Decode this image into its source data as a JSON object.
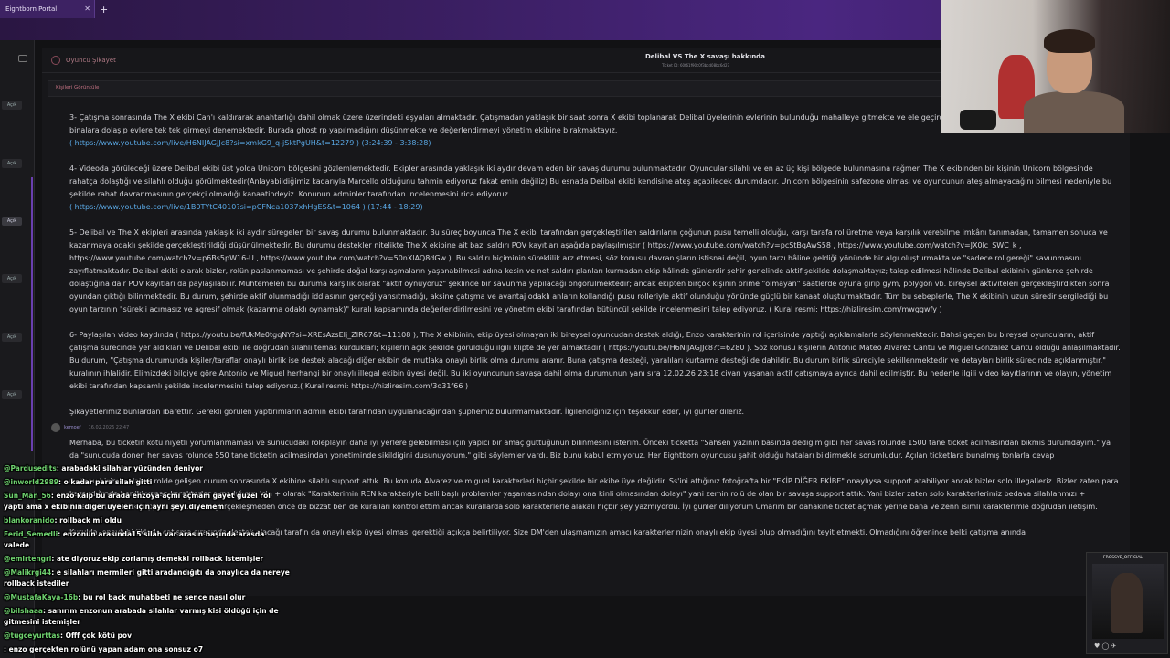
{
  "browser": {
    "tab_label": "Eightborn Portal",
    "tab_close": "✕",
    "new_tab": "+"
  },
  "sidebar": {
    "badges": [
      "Açık",
      "Açık",
      "Açık",
      "Açık",
      "Açık",
      "Açık"
    ]
  },
  "header": {
    "section": "Oyuncu Şikayet",
    "title": "Delibal VS The X savaşı hakkında",
    "ticket_id": "Ticket ID: 60f61f90c0f3bcd08bc6d27"
  },
  "subbar_label": "Kişileri Görüntüle",
  "report": {
    "p3": "3- Çatışma sonrasında The X ekibi Can'ı kaldırarak anahtarlığı dahil olmak üzere üzerindeki eşyaları almaktadır. Çatışmadan yaklaşık bir saat sonra X ekibi toplanarak Delibal üyelerinin evlerinin bulunduğu mahalleye gitmekte ve ele geçirdikleri anahtarlarla boyunca mahalledeki binalara dolaşıp evlere tek tek girmeyi denemektedir. Burada ghost rp yapılmadığını düşünmekte ve değerlendirmeyi yönetim ekibine bırakmaktayız.",
    "p3_link": "( https://www.youtube.com/live/H6NIJAGJJc8?si=xmkG9_q-jSktPgUH&t=12279 ) (3:24:39 - 3:38:28)",
    "p4": "4- Videoda görüleceği üzere Delibal ekibi üst yolda Unicorn bölgesini gözlemlemektedir. Ekipler arasında yaklaşık iki aydır devam eden bir savaş durumu bulunmaktadır. Oyuncular silahlı ve en az üç kişi bölgede bulunmasına rağmen The X ekibinden bir kişinin Unicorn bölgesinde rahatça dolaştığı ve silahlı olduğu görülmektedir(Anlayabildiğimiz kadarıyla Marcello olduğunu tahmin ediyoruz fakat emin değiliz) Bu esnada Delibal ekibi kendisine ateş açabilecek durumdadır. Unicorn bölgesinin safezone olması ve oyuncunun ateş almayacağını bilmesi nedeniyle bu şekilde rahat davranmasının gerçekçi olmadığı kanaatindeyiz. Konunun adminler tarafından incelenmesini rica ediyoruz.",
    "p4_link": "( https://www.youtube.com/live/1B0TYtC4010?si=pCFNca1037xhHgES&t=1064 ) (17:44 - 18:29)",
    "p5": "5- Delibal ve The X ekipleri arasında yaklaşık iki aydır süregelen bir savaş durumu bulunmaktadır. Bu süreç boyunca The X ekibi tarafından gerçekleştirilen saldırıların çoğunun pusu temelli olduğu, karşı tarafa rol üretme veya karşılık verebilme imkânı tanımadan, tamamen sonuca ve kazanmaya odaklı şekilde gerçekleştirildiği düşünülmektedir. Bu durumu destekler nitelikte The X ekibine ait bazı saldırı POV kayıtları aşağıda paylaşılmıştır ( https://www.youtube.com/watch?v=pcStBqAwS58 , https://www.youtube.com/watch?v=JX0lc_SWC_k , https://www.youtube.com/watch?v=p6Bs5pW16-U , https://www.youtube.com/watch?v=50nXlAQ8dGw ). Bu saldırı biçiminin süreklilik arz etmesi, söz konusu davranışların istisnai değil, oyun tarzı hâline geldiği yönünde bir algı oluşturmakta ve \"sadece rol gereği\" savunmasını zayıflatmaktadır. Delibal ekibi olarak bizler, rolün paslanmaması ve şehirde doğal karşılaşmaların yaşanabilmesi adına kesin ve net saldırı planları kurmadan ekip hâlinde günlerdir şehir genelinde aktif şekilde dolaşmaktayız; talep edilmesi hâlinde Delibal ekibinin günlerce şehirde dolaştığına dair POV kayıtları da paylaşılabilir. Muhtemelen bu duruma karşılık olarak \"aktif oynuyoruz\" şeklinde bir savunma yapılacağı öngörülmektedir; ancak ekipten birçok kişinin prime \"olmayan\" saatlerde oyuna girip gym, polygon vb. bireysel aktiviteleri gerçekleştirdikten sonra oyundan çıktığı bilinmektedir. Bu durum, şehirde aktif olunmadığı iddiasının gerçeği yansıtmadığı, aksine çatışma ve avantaj odaklı anların kollandığı pusu rolleriyle aktif olunduğu yönünde güçlü bir kanaat oluşturmaktadır. Tüm bu sebeplerle, The X ekibinin uzun süredir sergilediği bu oyun tarzının \"sürekli acımasız ve agresif olmak (kazanma odaklı oynamak)\" kuralı kapsamında değerlendirilmesini ve yönetim ekibi tarafından bütüncül şekilde incelenmesini talep ediyoruz. ( Kural resmi: https://hizliresim.com/mwggwfy )",
    "p6": "6- Paylaşılan video kaydında ( https://youtu.be/fUkMe0tgqNY?si=XREsAzsEIj_ZIR67&t=11108 ), The X ekibinin, ekip üyesi olmayan iki bireysel oyuncudan destek aldığı, Enzo karakterinin rol içerisinde yaptığı açıklamalarla söylenmektedir. Bahsi geçen bu bireysel oyuncuların, aktif çatışma sürecinde yer aldıkları ve Delibal ekibi ile doğrudan silahlı temas kurdukları; kişilerin açık şekilde görüldüğü ilgili klipte de yer almaktadır ( https://youtu.be/H6NIJAGJJc8?t=6280 ). Söz konusu kişilerin Antonio Mateo Alvarez Cantu ve Miguel Gonzalez Cantu olduğu anlaşılmaktadır. Bu durum, \"Çatışma durumunda kişiler/taraflar onaylı birlik ise destek alacağı diğer ekibin de mutlaka onaylı birlik olma durumu aranır. Buna çatışma desteği, yaralıları kurtarma desteği de dahildir. Bu durum birlik süreciyle sekillenmektedir ve detayları birlik sürecinde açıklanmıştır.\" kuralının ihlalidir. Elimizdeki bilgiye göre Antonio ve Miguel herhangi bir onaylı illegal ekibin üyesi değil. Bu iki oyuncunun savaşa dahil olma durumunun yanı sıra 12.02.26 23:18 civarı yaşanan aktif çatışmaya ayrıca dahil edilmiştir. Bu nedenle ilgili video kayıtlarının ve olayın, yönetim ekibi tarafından kapsamlı şekilde incelenmesini talep ediyoruz.( Kural resmi: https://hizliresim.com/3o31f66 )",
    "closing": "Şikayetlerimiz bunlardan ibarettir. Gerekli görülen yaptırımların admin ekibi tarafından uygulanacağından şüphemiz bulunmamaktadır. İlgilendiğiniz için teşekkür eder, iyi günler dileriz."
  },
  "reply": {
    "author": "kemoef",
    "date": "16.02.2026 22:47",
    "text1": "Merhaba, bu ticketin kötü niyetli yorumlanmaması ve sunucudaki roleplayin daha iyi yerlere gelebilmesi için yapıcı bir amaç güttüğünün bilinmesini isterim. Önceki ticketta \"Sahsen yazinin basinda dedigim gibi her savas rolunde 1500 tane ticket acilmasindan bikmis durumdayim.\" ya da \"sunucuda donen her savas rolunde 550 tane ticketin acilmasindan yonetiminde sikildigini dusunuyorum.\" gibi söylemler vardı. Biz bunu kabul etmiyoruz. Her Eightborn oyuncusu şahit olduğu hataları bildirmekle sorumludur. Açılan ticketlara bunalmış tonlarla cevap",
    "text2": "6- Konu bizimle alakalı rolde gelişen durum sonrasında X ekibine silahlı support attık. Bu konuda Alvarez ve miguel karakterleri hiçbir şekilde bir ekibe üye değildir. Ss'ini attığınız fotoğrafta bir \"EKİP DİĞER EKİBE\" onaylıysa support atabiliyor ancak bizler solo illegalleriz. Bizler zaten para kazandığında her iki yanan karakterler oynadığımız için + olarak \"Karakterimin REN karakteriyle belli başlı problemler yaşamasından dolayı ona kinli olmasından dolayı\" yani zemin rolü de olan bir savaşa support attık. Yani bizler zaten solo karakterlerimiz bedava silahlanmızı + paralanmızı alarak support attık. Bu rol gerçekleşmeden önce de bizzat ben de kuralları kontrol ettim ancak kurallarda solo karakterlerle alakalı hiçbir şey yazmıyordu. İyi günler diliyorum Umarım bir dahakine ticket açmak yerine bana ve zenn isimli karakterimle doğrudan iletişim.",
    "text3": "Kurulda, onaylı birliklerle çatışma sırasında destek alacağı tarafın da onaylı ekip üyesi olması gerektiği açıkça belirtiliyor. Size DM'den ulaşmamızın amacı karakterlerinizin onaylı ekip üyesi olup olmadığını teyit etmekti. Olmadığını öğrenince belki çatışma anında"
  },
  "chat": [
    {
      "user": "@Pardusedits",
      "msg": ": arabadaki silahlar yüzünden deniyor"
    },
    {
      "user": "@inworld2989",
      "msg": ": o kadar para silah gitti"
    },
    {
      "user": "Sun_Man_56",
      "msg": ": enzo kalp bu arada enzoya açmı açmam gayet güzel rol"
    },
    {
      "user": "",
      "msg": "yaptı ama x ekibinin diğer üyeleri için aynı şeyi diyemem"
    },
    {
      "user": "blankoranido",
      "msg": ": rollback mi oldu"
    },
    {
      "user": "Ferid_Semedli",
      "msg": ": enzonun arasında15 silah var arasın başında arasda"
    },
    {
      "user": "",
      "msg": "valede"
    },
    {
      "user": "@emirtengri",
      "msg": ": ate diyoruz ekip zorlamış demekki rollback istemişler"
    },
    {
      "user": "@Malikrgi44",
      "msg": ": e silahları mermileri gitti aradandığıtı da onaylıca da nereye"
    },
    {
      "user": "",
      "msg": "rollback istediler"
    },
    {
      "user": "@MustafaKaya-16b",
      "msg": ": bu rol back muhabbeti ne sence nasıl olur"
    },
    {
      "user": "@bilshaaa",
      "msg": ": sanırım enzonun arabada silahlar varmış kisi öldüğü için de"
    },
    {
      "user": "",
      "msg": "gitmesini istemişler"
    },
    {
      "user": "@tugceyurttas",
      "msg": ": Offf çok kötü pov"
    },
    {
      "user": "",
      "msg": ": enzo gerçekten rolünü yapan adam ona sonsuz o7"
    }
  ],
  "ad": {
    "title": "FROSSYE_OFFICIAL",
    "icons": "♥ ◯ ✈"
  }
}
